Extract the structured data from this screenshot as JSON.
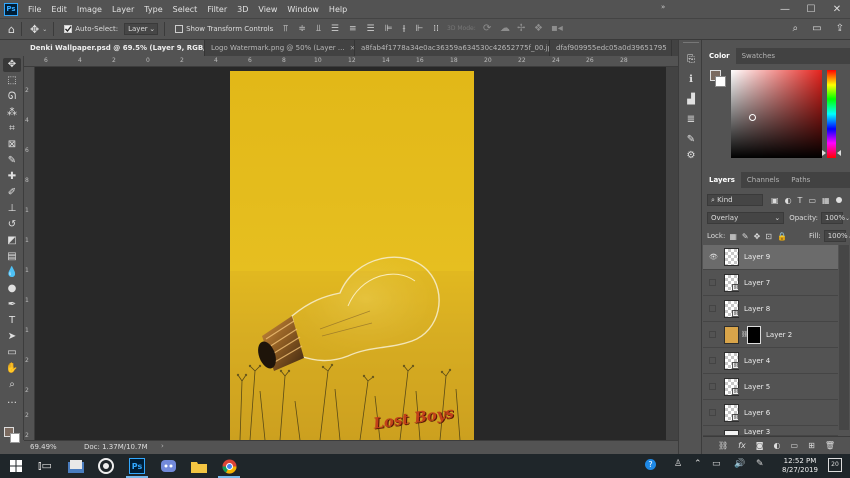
{
  "app": {
    "logo_text": "Ps",
    "menus": [
      "File",
      "Edit",
      "Image",
      "Layer",
      "Type",
      "Select",
      "Filter",
      "3D",
      "View",
      "Window",
      "Help"
    ],
    "window_controls": {
      "minimize": "—",
      "maximize": "☐",
      "close": "✕"
    }
  },
  "options_bar": {
    "auto_select_label": "Auto-Select:",
    "auto_select_checked": true,
    "auto_select_target": "Layer",
    "transform_controls_label": "Show Transform Controls",
    "transform_controls_checked": false,
    "mode_3d_label": "3D Mode:"
  },
  "tabs": [
    {
      "label": "Denki Wallpaper.psd @ 69.5% (Layer 9, RGB/8#) *",
      "active": true
    },
    {
      "label": "Logo Watermark.png @ 50% (Layer ...",
      "active": false
    },
    {
      "label": "a8fab4f1778a34e0ac36359a634530c42652775f_00.jpg",
      "active": false
    },
    {
      "label": "dfaf909955edc05a0d39651795",
      "active": false
    }
  ],
  "tab_overflow": "»",
  "rulers": {
    "top": [
      "6",
      "4",
      "2",
      "0",
      "2",
      "4",
      "6",
      "8",
      "10",
      "12",
      "14",
      "16",
      "18",
      "20",
      "22",
      "24",
      "26",
      "28"
    ],
    "left": [
      "2",
      "4",
      "6",
      "8",
      "1",
      "1",
      "1",
      "1",
      "1",
      "2",
      "2",
      "2",
      "2"
    ]
  },
  "artwork": {
    "watermark_text": "Lost Boys"
  },
  "status": {
    "zoom": "69.49%",
    "doc_size": "Doc: 1.37M/10.7M"
  },
  "color_panel": {
    "tabs": [
      "Color",
      "Swatches"
    ],
    "foreground_color": "#7b6a5f",
    "background_color": "#ffffff"
  },
  "layers_panel": {
    "tabs": [
      "Layers",
      "Channels",
      "Paths"
    ],
    "kind_label": "Kind",
    "blend_mode": "Overlay",
    "opacity_label": "Opacity:",
    "opacity_value": "100%",
    "lock_label": "Lock:",
    "fill_label": "Fill:",
    "fill_value": "100%",
    "layers": [
      {
        "name": "Layer 9",
        "visible": true,
        "selected": true,
        "linked": false,
        "mask": false
      },
      {
        "name": "Layer 7",
        "visible": false,
        "selected": false,
        "linked": true,
        "mask": false
      },
      {
        "name": "Layer 8",
        "visible": false,
        "selected": false,
        "linked": true,
        "mask": false
      },
      {
        "name": "Layer 2",
        "visible": false,
        "selected": false,
        "linked": false,
        "mask": true
      },
      {
        "name": "Layer 4",
        "visible": false,
        "selected": false,
        "linked": true,
        "mask": false
      },
      {
        "name": "Layer 5",
        "visible": false,
        "selected": false,
        "linked": true,
        "mask": false
      },
      {
        "name": "Layer 6",
        "visible": false,
        "selected": false,
        "linked": true,
        "mask": false
      },
      {
        "name": "Layer 3",
        "visible": false,
        "selected": false,
        "linked": false,
        "mask": false
      }
    ],
    "bottom_icons": [
      "link-icon",
      "fx-icon",
      "mask-icon",
      "adjustment-icon",
      "group-icon",
      "new-layer-icon",
      "trash-icon"
    ]
  },
  "taskbar": {
    "clock_time": "12:52 PM",
    "clock_date": "8/27/2019",
    "notification_count": "20"
  },
  "colors": {
    "ui_bg": "#535353",
    "canvas_bg": "#282828",
    "artwork_yellow": "#e2b818",
    "taskbar_bg": "#1f262a",
    "accent_blue": "#31a8ff"
  }
}
